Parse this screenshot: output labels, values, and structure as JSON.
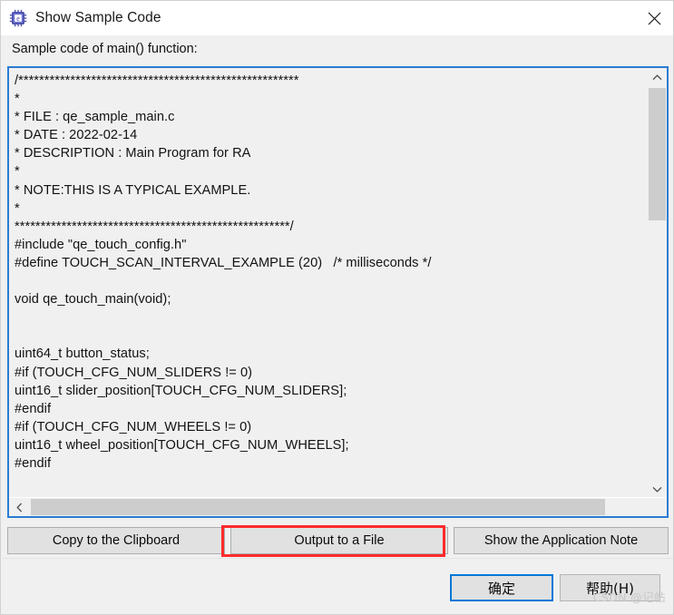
{
  "window": {
    "title": "Show Sample Code",
    "icon": "chip-icon",
    "close_icon": "close-icon"
  },
  "content": {
    "section_label": "Sample code of main() function:",
    "code": "/******************************************************\n*\n* FILE : qe_sample_main.c\n* DATE : 2022-02-14\n* DESCRIPTION : Main Program for RA\n*\n* NOTE:THIS IS A TYPICAL EXAMPLE.\n*\n*****************************************************/\n#include \"qe_touch_config.h\"\n#define TOUCH_SCAN_INTERVAL_EXAMPLE (20)   /* milliseconds */\n\nvoid qe_touch_main(void);\n\n\nuint64_t button_status;\n#if (TOUCH_CFG_NUM_SLIDERS != 0)\nuint16_t slider_position[TOUCH_CFG_NUM_SLIDERS];\n#endif\n#if (TOUCH_CFG_NUM_WHEELS != 0)\nuint16_t wheel_position[TOUCH_CFG_NUM_WHEELS];\n#endif"
  },
  "scrollbars": {
    "vertical": {
      "up_icon": "chevron-up-icon",
      "down_icon": "chevron-down-icon"
    },
    "horizontal": {
      "left_icon": "chevron-left-icon",
      "right_icon": "chevron-right-icon"
    }
  },
  "actions": {
    "copy_label": "Copy to the Clipboard",
    "output_label": "Output to a File",
    "note_label": "Show the Application Note"
  },
  "footer": {
    "ok_label": "确定",
    "help_label": "帮助(H)",
    "watermark": "CSDN @记帖"
  },
  "colors": {
    "focus_blue": "#0078d7",
    "panel_border_blue": "#2b7cd3",
    "highlight_red": "#fc2b2b",
    "button_face": "#e1e1e1",
    "dialog_bg": "#f0f0f0"
  }
}
